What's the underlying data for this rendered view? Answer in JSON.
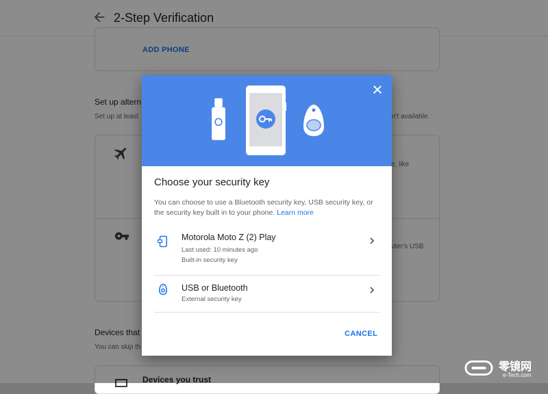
{
  "header": {
    "title": "2-Step Verification"
  },
  "background": {
    "add_phone": "ADD PHONE",
    "alt_heading": "Set up altern",
    "alt_sub": "Set up at least",
    "alt_sub_right": "n't available.",
    "row1_right": "e, like",
    "row2_right": "uter's USB",
    "devices_heading": "Devices that",
    "devices_sub": "You can skip th",
    "devices_trust": "Devices you trust"
  },
  "dialog": {
    "title": "Choose your security key",
    "description": "You can choose to use a Bluetooth security key, USB security key, or the security key built in to your phone.",
    "learn_more": "Learn more",
    "options": [
      {
        "name": "Motorola Moto Z (2) Play",
        "line1": "Last used: 10 minutes ago",
        "line2": "Built-in security key",
        "icon": "phone-key-icon"
      },
      {
        "name": "USB or Bluetooth",
        "line1": "External security key",
        "icon": "security-key-icon"
      }
    ],
    "cancel": "CANCEL"
  },
  "watermark": {
    "brand": "零镜网",
    "site": "e-Tech.com"
  },
  "colors": {
    "accent": "#1a73e8",
    "hero": "#4a86e8"
  }
}
